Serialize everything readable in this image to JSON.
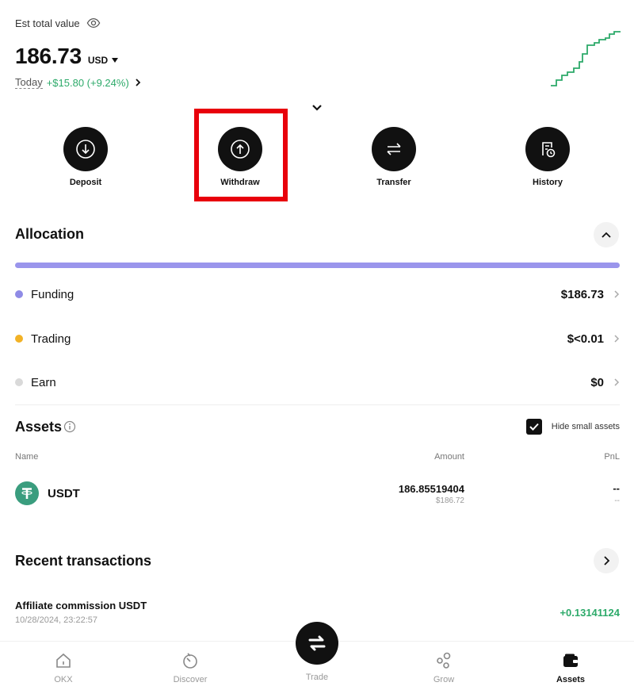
{
  "header": {
    "est_label": "Est total value",
    "total_value": "186.73",
    "currency": "USD",
    "today_label": "Today",
    "today_change": "+$15.80 (+9.24%)"
  },
  "actions": [
    {
      "label": "Deposit",
      "icon": "arrow-down-circle-icon"
    },
    {
      "label": "Withdraw",
      "icon": "arrow-up-circle-icon"
    },
    {
      "label": "Transfer",
      "icon": "swap-arrows-icon"
    },
    {
      "label": "History",
      "icon": "history-document-icon"
    }
  ],
  "allocation": {
    "title": "Allocation",
    "bar_color": "#9a95ec",
    "rows": [
      {
        "name": "Funding",
        "value": "$186.73",
        "color": "#8f8be6"
      },
      {
        "name": "Trading",
        "value": "$<0.01",
        "color": "#f2b226"
      },
      {
        "name": "Earn",
        "value": "$0",
        "color": "#d9d9d9"
      }
    ]
  },
  "assets": {
    "title": "Assets",
    "hide_small_label": "Hide small assets",
    "hide_small_checked": true,
    "columns": {
      "name": "Name",
      "amount": "Amount",
      "pnl": "PnL"
    },
    "rows": [
      {
        "name": "USDT",
        "amount": "186.85519404",
        "amount_usd": "$186.72",
        "pnl": "--",
        "pnl_sub": "--"
      }
    ]
  },
  "recent": {
    "title": "Recent transactions",
    "items": [
      {
        "title": "Affiliate commission USDT",
        "time": "10/28/2024, 23:22:57",
        "amount": "+0.13141124"
      }
    ]
  },
  "nav": {
    "items": [
      {
        "label": "OKX",
        "icon": "home-icon"
      },
      {
        "label": "Discover",
        "icon": "discover-icon"
      },
      {
        "label": "Trade",
        "icon": "trade-swap-icon"
      },
      {
        "label": "Grow",
        "icon": "grow-icon"
      },
      {
        "label": "Assets",
        "icon": "wallet-icon"
      }
    ],
    "active": "Assets"
  },
  "colors": {
    "positive": "#2daa6a",
    "highlight": "#e8000b"
  }
}
